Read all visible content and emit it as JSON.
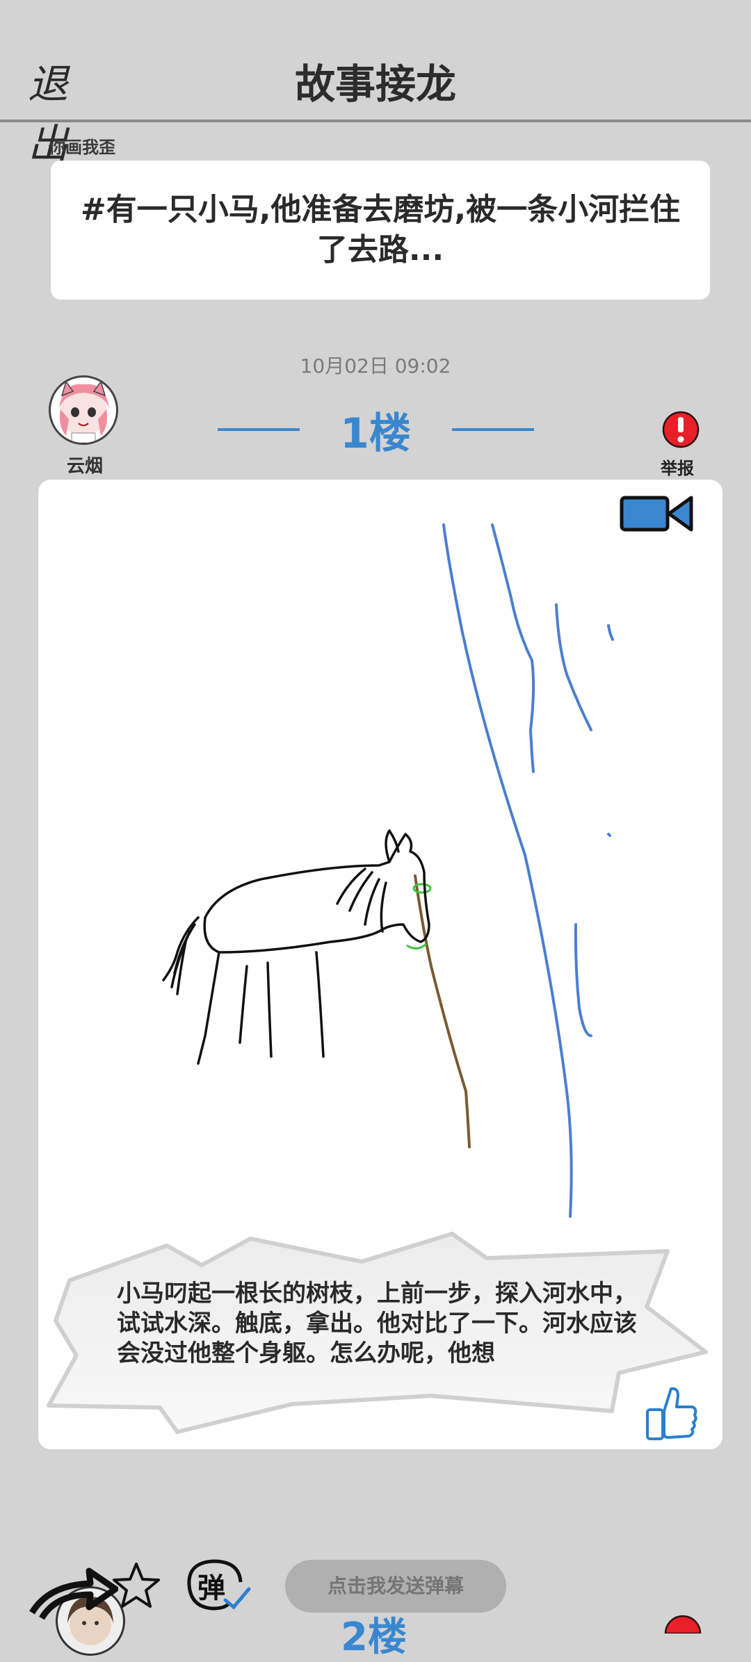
{
  "header": {
    "exit_label": "退出",
    "title": "故事接龙"
  },
  "story": {
    "author": "你画我歪",
    "prompt": "#有一只小马,他准备去磨坊,被一条小河拦住了去路..."
  },
  "post": {
    "timestamp": "10月02日  09:02",
    "floor_label": "1楼",
    "username": "云烟",
    "report_label": "举报",
    "caption": "小马叼起一根长的树枝，上前一步，探入河水中，试试水深。触底，拿出。他对比了一下。河水应该会没过他整个身躯。怎么办呢，他想"
  },
  "bottom_bar": {
    "danmaku_placeholder": "点击我发送弹幕",
    "danmaku_icon_label": "弹",
    "next_floor_label": "2楼"
  },
  "icons": {
    "video": "video-camera-icon",
    "report": "exclamation-icon",
    "like": "thumbs-up-icon",
    "favorite": "star-icon",
    "share": "share-arrow-icon"
  },
  "colors": {
    "background": "#d3d3d3",
    "accent_blue": "#3a87cf",
    "report_red": "#e8202a",
    "river_blue": "#4a7fd0",
    "stick_brown": "#7a5a30",
    "grass_green": "#3cc43c"
  }
}
